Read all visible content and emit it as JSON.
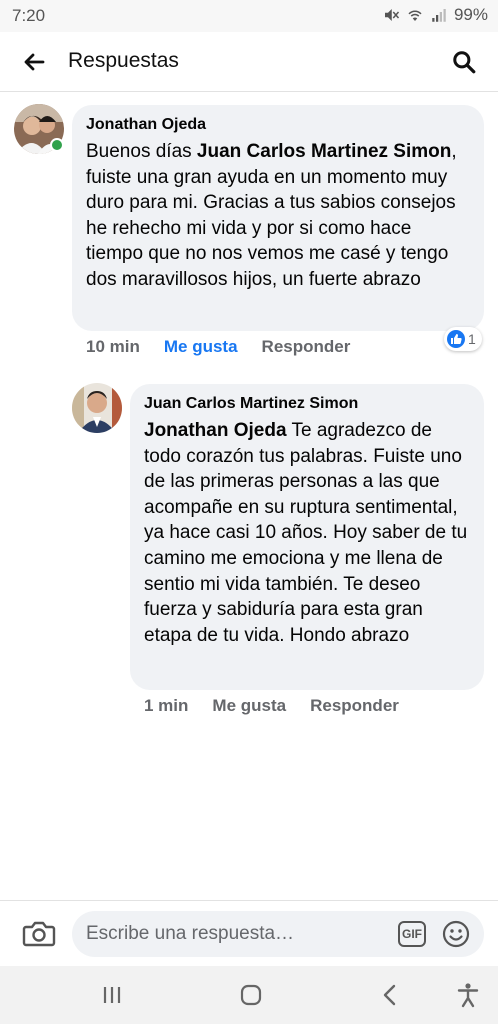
{
  "status_bar": {
    "time": "7:20",
    "battery": "99%",
    "icons": [
      "mute-icon",
      "wifi-icon",
      "signal-icon"
    ]
  },
  "header": {
    "title": "Respuestas",
    "back_icon": "arrow-left-icon",
    "search_icon": "search-icon"
  },
  "comments": [
    {
      "author": "Jonathan Ojeda",
      "text_intro": "Buenos días ",
      "mention": "Juan Carlos Martinez Simon",
      "text_rest": ", fuiste una gran ayuda en un momento muy duro para mi. Gracias a tus sabios consejos he rehecho mi vida y por si como hace tiempo que no nos vemos me casé y tengo dos maravillosos hijos, un fuerte abrazo",
      "time": "10 min",
      "like_label": "Me gusta",
      "reply_label": "Responder",
      "reaction_count": "1",
      "online": true
    },
    {
      "author": "Juan Carlos Martinez Simon",
      "mention": "Jonathan Ojeda",
      "text_rest": " Te agradezco de todo corazón tus palabras. Fuiste uno de las primeras personas a las que acompañe en su ruptura sentimental, ya hace casi 10 años. Hoy saber de tu camino me emociona y me llena de sentio mi vida también. Te deseo fuerza y sabiduría para esta gran etapa de tu vida. Hondo abrazo",
      "time": "1 min",
      "like_label": "Me gusta",
      "reply_label": "Responder"
    }
  ],
  "composer": {
    "placeholder": "Escribe una respuesta…",
    "gif_label": "GIF",
    "camera_icon": "camera-icon",
    "emoji_icon": "emoji-icon"
  },
  "colors": {
    "accent": "#1877f2",
    "bubble": "#f0f2f5",
    "meta_text": "#65676b",
    "online": "#31a24c"
  }
}
